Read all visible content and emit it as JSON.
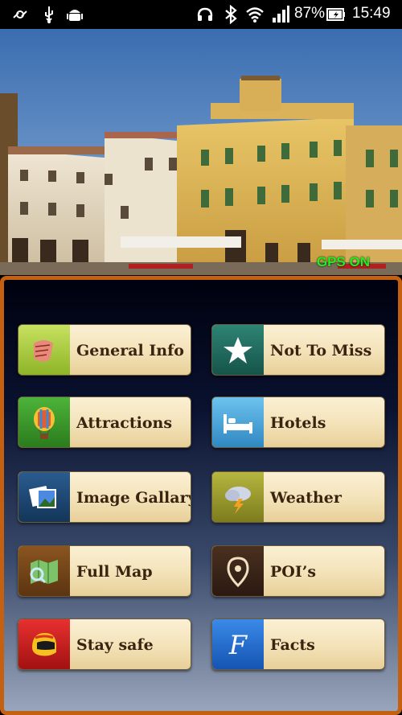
{
  "status_bar": {
    "battery": "87%",
    "time": "15:49",
    "icons": [
      "location-icon",
      "usb-icon",
      "android-icon",
      "headset-icon",
      "bluetooth-icon",
      "wifi-icon",
      "signal-icon",
      "battery-icon"
    ]
  },
  "hero": {
    "gps_status": "GPS ON",
    "gps_color": "#22ee22"
  },
  "menu": {
    "accent_border": "#c4600f",
    "items": [
      {
        "label": "General Info",
        "icon": "scroll-icon",
        "icon_bg": "#a7c73a"
      },
      {
        "label": "Not To Miss",
        "icon": "star-icon",
        "icon_bg": "#1f6a5e"
      },
      {
        "label": "Attractions",
        "icon": "balloon-icon",
        "icon_bg": "#3d9a2b"
      },
      {
        "label": "Hotels",
        "icon": "bed-icon",
        "icon_bg": "#4aa7d8"
      },
      {
        "label": "Image Gallary",
        "icon": "photos-icon",
        "icon_bg": "#1c4a78"
      },
      {
        "label": "Weather",
        "icon": "storm-cloud-icon",
        "icon_bg": "#9a9a2c"
      },
      {
        "label": "Full Map",
        "icon": "map-icon",
        "icon_bg": "#6a3c12"
      },
      {
        "label": "POI’s",
        "icon": "location-pin-icon",
        "icon_bg": "#3a2414"
      },
      {
        "label": "Stay safe",
        "icon": "helmet-icon",
        "icon_bg": "#d01818"
      },
      {
        "label": "Facts",
        "icon": "letter-f-icon",
        "icon_bg": "#1c6ad0"
      }
    ]
  }
}
